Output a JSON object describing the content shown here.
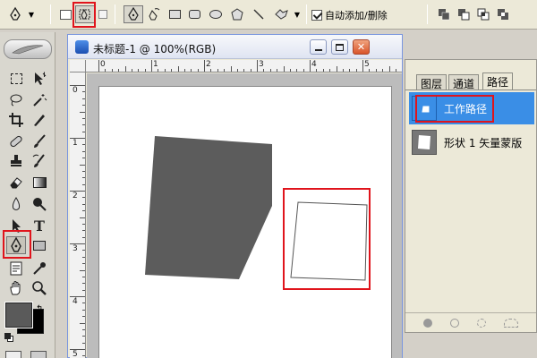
{
  "options_bar": {
    "auto_add_delete_label": "自动添加/删除",
    "auto_add_delete_checked": true
  },
  "document": {
    "title": "未标题-1 @ 100%(RGB)",
    "ruler_h_labels": [
      "0",
      "1",
      "2",
      "3",
      "4",
      "5"
    ],
    "ruler_v_labels": [
      "0",
      "1",
      "2",
      "3",
      "4",
      "5"
    ]
  },
  "paths_panel": {
    "tabs": [
      "图层",
      "通道",
      "路径"
    ],
    "active_tab": "路径",
    "items": [
      {
        "label": "工作路径",
        "selected": true
      },
      {
        "label": "形状 1 矢量蒙版",
        "selected": false
      }
    ]
  },
  "colors": {
    "foreground": "#5a5a5a",
    "background": "#000000",
    "shape_fill": "#5c5c5c",
    "highlight": "#e0141c",
    "selection": "#3a8ee6"
  }
}
